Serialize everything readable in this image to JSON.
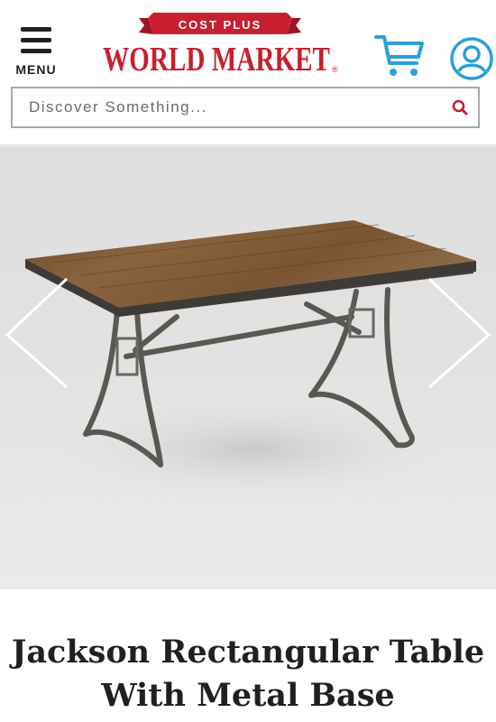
{
  "header": {
    "menu_label": "MENU",
    "logo_top": "COST PLUS",
    "logo_main": "WORLD MARKET",
    "logo_mark": "®",
    "brand_color": "#c8202f",
    "cart_icon": "cart-icon",
    "account_icon": "user-icon"
  },
  "search": {
    "placeholder": "Discover Something...",
    "icon": "search-icon",
    "accent_color": "#c8202f"
  },
  "gallery": {
    "image": "rectangular wood table with metal base",
    "prev_icon": "chevron-left-icon",
    "next_icon": "chevron-right-icon"
  },
  "product": {
    "title": "Jackson Rectangular Table With Metal Base"
  }
}
